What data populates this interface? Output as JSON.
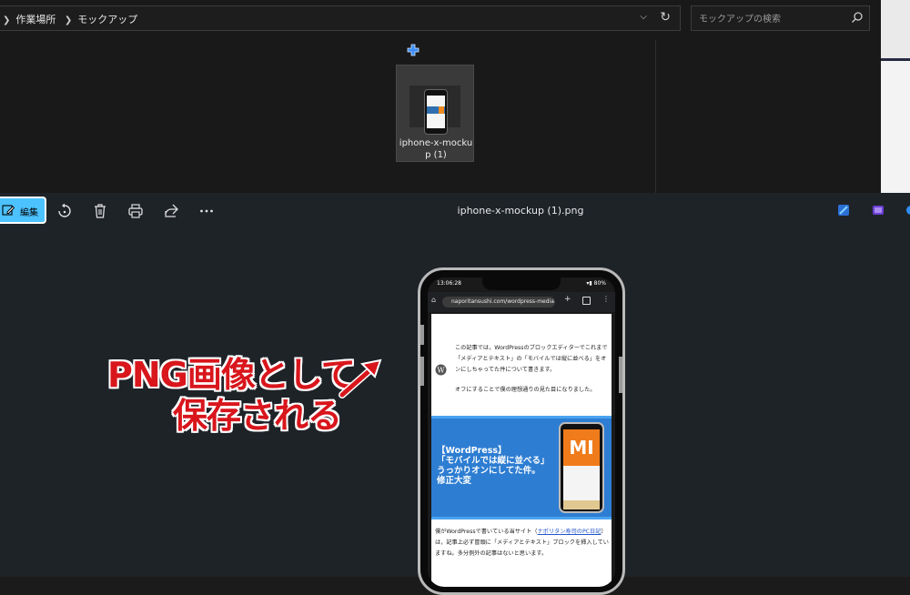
{
  "explorer": {
    "breadcrumb": [
      "作業場所",
      "モックアップ"
    ],
    "search_placeholder": "モックアップの検索",
    "file": {
      "name_line1": "iphone-x-mocku",
      "name_line2": "p (1)"
    }
  },
  "photos": {
    "edit_label": "編集",
    "file_title": "iphone-x-mockup (1).png",
    "annotation": {
      "line1": "PNG画像として",
      "line2": "保存される"
    },
    "phone": {
      "status_time": "13:06:28",
      "status_right": "80%",
      "url": "naporitansushi.com/wordpress-media",
      "intro_text": "この記事では，WordPressのブロックエディターでこれまで「メディアとテキスト」の「モバイルでは縦に並べる」をオンにしちゃってた件について書きます。",
      "intro_text2": "オフにすることで僕の理想通りの見た目になりました。",
      "banner": {
        "line1": "【WordPress】",
        "line2": "「モバイルでは縦に並べる」",
        "line3": "うっかりオンにしてた件。",
        "line4": "修正大変",
        "logo": "MI"
      },
      "body_pre": "僕がWordPressで書いている当サイト（",
      "body_link": "ナポリタン寿司のPC日記",
      "body_post": "）は，記事上必ず冒頭に「メディアとテキスト」ブロックを挿入していますね。多分例外の記事はないと思います。"
    }
  }
}
